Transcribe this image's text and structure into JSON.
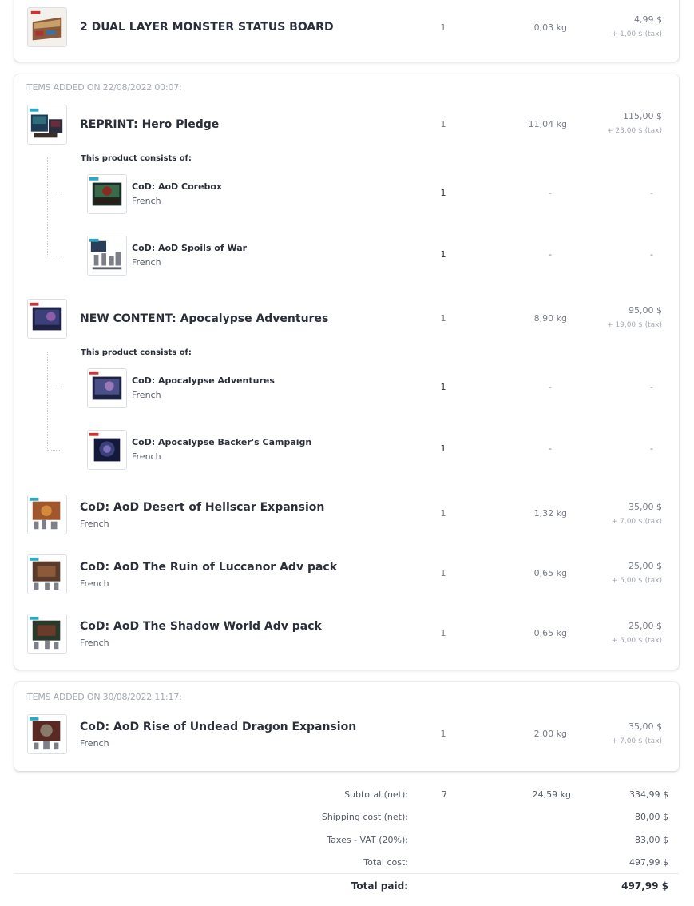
{
  "group0": {
    "items": [
      {
        "title": "2 DUAL LAYER MONSTER STATUS BOARD",
        "qty": "1",
        "weight": "0,03 kg",
        "price": "4,99 $",
        "tax": "+ 1,00 $ (tax)",
        "icon": "status-board-thumbnail"
      }
    ]
  },
  "group1": {
    "header": "ITEMS ADDED ON 22/08/2022 00:07:",
    "items": [
      {
        "title": "REPRINT: Hero Pledge",
        "qty": "1",
        "weight": "11,04 kg",
        "price": "115,00 $",
        "tax": "+ 23,00 $ (tax)",
        "consists_label": "This product consists of:",
        "components": [
          {
            "title": "CoD: AoD Corebox",
            "lang": "French",
            "qty": "1",
            "weight": "-",
            "price": "-"
          },
          {
            "title": "CoD: AoD Spoils of War",
            "lang": "French",
            "qty": "1",
            "weight": "-",
            "price": "-"
          }
        ]
      },
      {
        "title": "NEW CONTENT: Apocalypse Adventures",
        "qty": "1",
        "weight": "8,90 kg",
        "price": "95,00 $",
        "tax": "+ 19,00 $ (tax)",
        "consists_label": "This product consists of:",
        "components": [
          {
            "title": "CoD: Apocalypse Adventures",
            "lang": "French",
            "qty": "1",
            "weight": "-",
            "price": "-"
          },
          {
            "title": "CoD: Apocalypse Backer's Campaign",
            "lang": "French",
            "qty": "1",
            "weight": "-",
            "price": "-"
          }
        ]
      },
      {
        "title": "CoD: AoD Desert of Hellscar Expansion",
        "lang": "French",
        "qty": "1",
        "weight": "1,32 kg",
        "price": "35,00 $",
        "tax": "+ 7,00 $ (tax)"
      },
      {
        "title": "CoD: AoD The Ruin of Luccanor Adv pack",
        "lang": "French",
        "qty": "1",
        "weight": "0,65 kg",
        "price": "25,00 $",
        "tax": "+ 5,00 $ (tax)"
      },
      {
        "title": "CoD: AoD The Shadow World Adv pack",
        "lang": "French",
        "qty": "1",
        "weight": "0,65 kg",
        "price": "25,00 $",
        "tax": "+ 5,00 $ (tax)"
      }
    ]
  },
  "group2": {
    "header": "ITEMS ADDED ON 30/08/2022 11:17:",
    "items": [
      {
        "title": "CoD: AoD Rise of Undead Dragon Expansion",
        "lang": "French",
        "qty": "1",
        "weight": "2,00 kg",
        "price": "35,00 $",
        "tax": "+ 7,00 $ (tax)"
      }
    ]
  },
  "totals": {
    "subtotal_label": "Subtotal (net):",
    "subtotal_qty": "7",
    "subtotal_weight": "24,59 kg",
    "subtotal_value": "334,99 $",
    "shipping_label": "Shipping cost (net):",
    "shipping_value": "80,00 $",
    "taxes_label": "Taxes - VAT (20%):",
    "taxes_value": "83,00 $",
    "total_label": "Total cost:",
    "total_value": "497,99 $",
    "paid_label": "Total paid:",
    "paid_value": "497,99 $"
  },
  "colors": {
    "accent_box": "#1f3a5a",
    "badge": "#2aa8c4",
    "text_primary": "#2b2f3a",
    "text_muted": "#a3a8b2"
  }
}
